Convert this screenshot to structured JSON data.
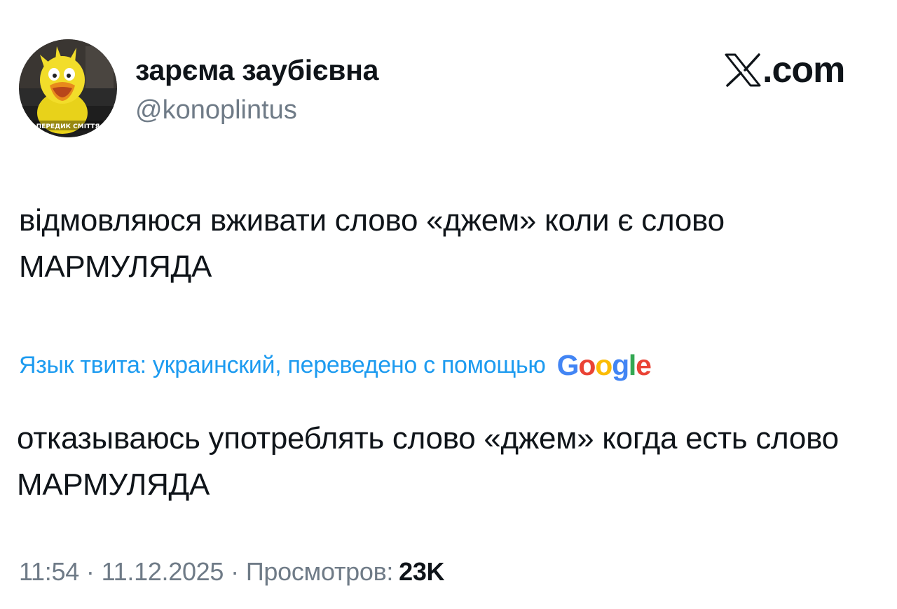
{
  "author": {
    "display_name": "зарєма заубієвна",
    "handle": "@konoplintus",
    "avatar_caption": "ПЕРЕДИК СМІТТЯ"
  },
  "brand": {
    "text": ".com"
  },
  "tweet": {
    "text": "відмовляюся вживати слово «джем» коли є слово МАРМУЛЯДА"
  },
  "translation": {
    "label": "Язык твита: украинский, переведено с помощью",
    "provider": {
      "letters": [
        "G",
        "o",
        "o",
        "g",
        "l",
        "e"
      ],
      "colors": [
        "#4285f4",
        "#ea4335",
        "#fbbc05",
        "#4285f4",
        "#34a853",
        "#ea4335"
      ]
    },
    "text": "отказываюсь употреблять слово «джем» когда есть слово МАРМУЛЯДА"
  },
  "meta": {
    "time": "11:54",
    "separator": "·",
    "date": "11.12.2025",
    "views_label": "Просмотров:",
    "views_count": "23K"
  }
}
